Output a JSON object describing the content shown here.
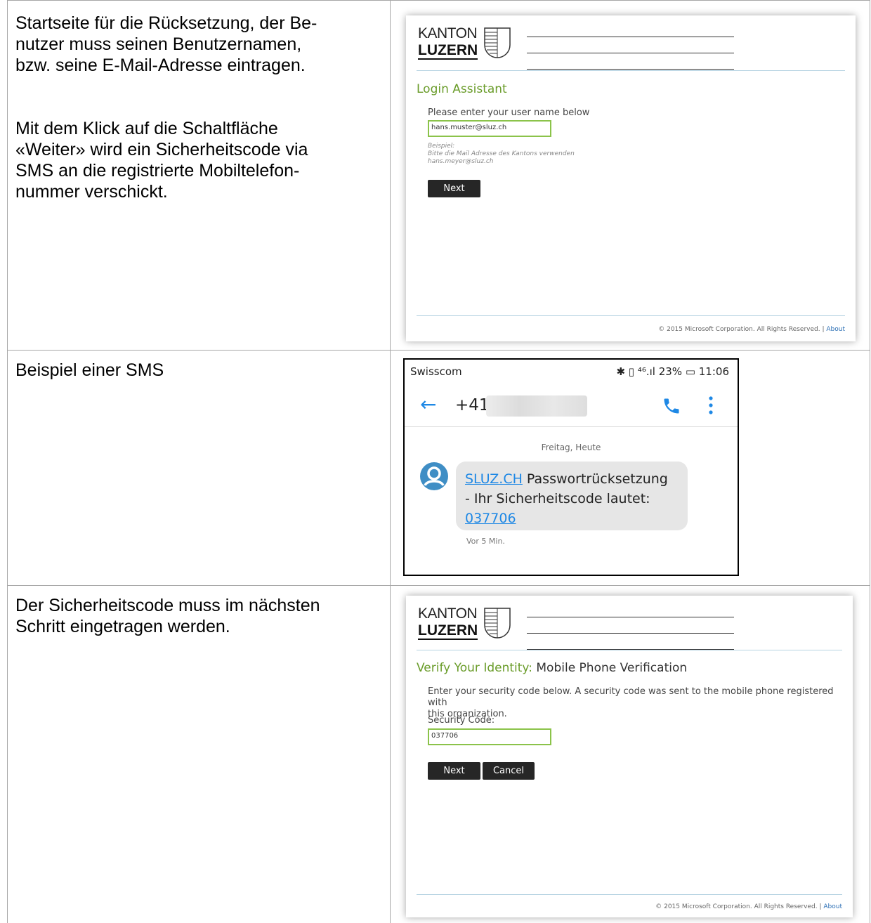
{
  "rows": [
    {
      "description": [
        "Startseite für die Rücksetzung, der Be-",
        "nutzer muss seinen Benutzernamen,",
        "bzw. seine E-Mail-Adresse eintragen.",
        "Mit dem Klick auf die Schaltfläche",
        "«Weiter» wird ein Sicherheitscode via",
        "SMS an die registrierte Mobiltelefon-",
        "nummer verschickt."
      ]
    },
    {
      "description": [
        "Beispiel einer SMS"
      ]
    },
    {
      "description": [
        "Der Sicherheitscode muss im nächsten",
        "Schritt eingetragen werden."
      ]
    }
  ],
  "logo": {
    "line1": "KANTON",
    "line2": "LUZERN"
  },
  "login_panel": {
    "title": "Login Assistant",
    "prompt": "Please enter your user name below",
    "username_value": "hans.muster@sluz.ch",
    "hint_line1": "Beispiel:",
    "hint_line2": "Bitte die Mail Adresse des Kantons verwenden",
    "hint_line3": "hans.meyer@sluz.ch",
    "next_label": "Next",
    "footer_text": "© 2015 Microsoft Corporation. All Rights Reserved.",
    "footer_sep": "|",
    "footer_link": "About"
  },
  "sms": {
    "carrier": "Swisscom",
    "status": "✱ ▯ ⁴⁶.ıl 23% ▭ 11:06",
    "back_icon": "arrow-left-icon",
    "number": "+41 7",
    "date": "Freitag, Heute",
    "link": "SLUZ.CH",
    "text1": " Passwortrücksetzung",
    "text2": "- Ihr Sicherheitscode lautet:",
    "code": "037706",
    "time": "Vor 5 Min."
  },
  "verify_panel": {
    "title": "Verify Your Identity:",
    "subtitle": "Mobile Phone Verification",
    "instruction_line1": "Enter your security code below. A security code was sent to the mobile phone registered with",
    "instruction_line2": "this organization.",
    "code_label": "Security Code:",
    "code_value": "037706",
    "next_label": "Next",
    "cancel_label": "Cancel",
    "footer_text": "© 2015 Microsoft Corporation. All Rights Reserved.",
    "footer_sep": "|",
    "footer_link": "About"
  },
  "colors": {
    "accent_green": "#6a9c2a",
    "link_blue": "#2c6fb5",
    "button_dark": "#262626",
    "sms_blue": "#1e88e5"
  }
}
